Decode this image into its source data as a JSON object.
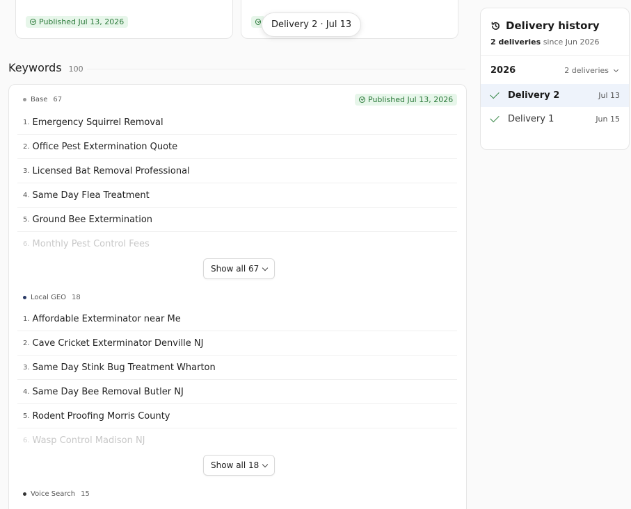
{
  "top_cards": [
    {
      "badge": "Published Jul 13, 2026"
    },
    {
      "badge": "Published Jul 13, 2026"
    }
  ],
  "tooltip": "Delivery 2 · Jul 13",
  "keywords": {
    "title": "Keywords",
    "count": "100",
    "groups": [
      {
        "name": "Base",
        "count": "67",
        "badge": "Published Jul 13, 2026",
        "items": [
          {
            "num": "1.",
            "text": "Emergency Squirrel Removal"
          },
          {
            "num": "2.",
            "text": "Office Pest Extermination Quote"
          },
          {
            "num": "3.",
            "text": "Licensed Bat Removal Professional"
          },
          {
            "num": "4.",
            "text": "Same Day Flea Treatment"
          },
          {
            "num": "5.",
            "text": "Ground Bee Extermination"
          },
          {
            "num": "6.",
            "text": "Monthly Pest Control Fees"
          }
        ],
        "show_all": "Show all 67"
      },
      {
        "name": "Local GEO",
        "count": "18",
        "items": [
          {
            "num": "1.",
            "text": "Affordable Exterminator near Me"
          },
          {
            "num": "2.",
            "text": "Cave Cricket Exterminator Denville NJ"
          },
          {
            "num": "3.",
            "text": "Same Day Stink Bug Treatment Wharton"
          },
          {
            "num": "4.",
            "text": "Same Day Bee Removal Butler NJ"
          },
          {
            "num": "5.",
            "text": "Rodent Proofing Morris County"
          },
          {
            "num": "6.",
            "text": "Wasp Control Madison NJ"
          }
        ],
        "show_all": "Show all 18"
      },
      {
        "name": "Voice Search",
        "count": "15"
      }
    ]
  },
  "delivery_history": {
    "title": "Delivery history",
    "subtitle_bold": "2 deliveries",
    "subtitle_rest": " since Jun 2026",
    "year": "2026",
    "year_count": "2 deliveries",
    "items": [
      {
        "label": "Delivery 2",
        "date": "Jul 13"
      },
      {
        "label": "Delivery 1",
        "date": "Jun 15"
      }
    ]
  },
  "colors": {
    "accent_green": "#2b7a3a",
    "badge_bg": "#e7f6ea",
    "active_row": "#eef3fb"
  }
}
